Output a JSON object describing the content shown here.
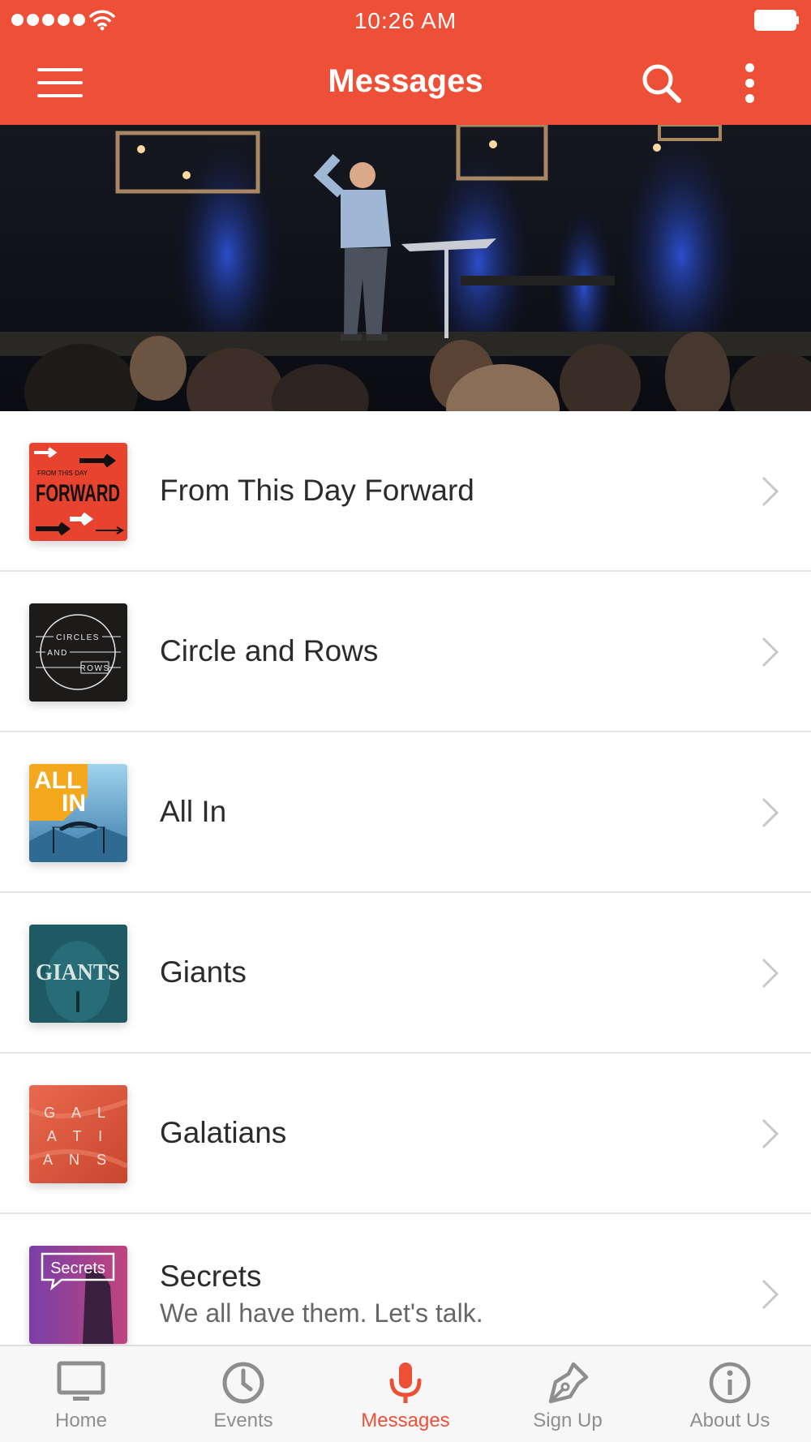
{
  "status_bar": {
    "time": "10:26 AM"
  },
  "header": {
    "title": "Messages"
  },
  "series": [
    {
      "title": "From This Day Forward",
      "subtitle": "",
      "thumb_text": [
        "FROM THIS DAY",
        "FORWARD"
      ]
    },
    {
      "title": "Circle and Rows",
      "subtitle": "",
      "thumb_text": [
        "CIRCLES",
        "AND",
        "ROWS"
      ]
    },
    {
      "title": "All In",
      "subtitle": "",
      "thumb_text": [
        "ALL",
        "IN"
      ]
    },
    {
      "title": "Giants",
      "subtitle": "",
      "thumb_text": [
        "GIANTS"
      ]
    },
    {
      "title": "Galatians",
      "subtitle": "",
      "thumb_text": [
        "G A L",
        "A T I",
        "A N S"
      ]
    },
    {
      "title": "Secrets",
      "subtitle": "We all have them. Let's talk.",
      "thumb_text": [
        "Secrets"
      ]
    }
  ],
  "tabs": [
    {
      "label": "Home",
      "icon": "monitor-icon",
      "active": false
    },
    {
      "label": "Events",
      "icon": "clock-icon",
      "active": false
    },
    {
      "label": "Messages",
      "icon": "microphone-icon",
      "active": true
    },
    {
      "label": "Sign Up",
      "icon": "pen-icon",
      "active": false
    },
    {
      "label": "About Us",
      "icon": "info-icon",
      "active": false
    }
  ],
  "colors": {
    "accent": "#ee4f37",
    "tab_inactive": "#8e8e8e",
    "divider": "#e6e6e6"
  }
}
